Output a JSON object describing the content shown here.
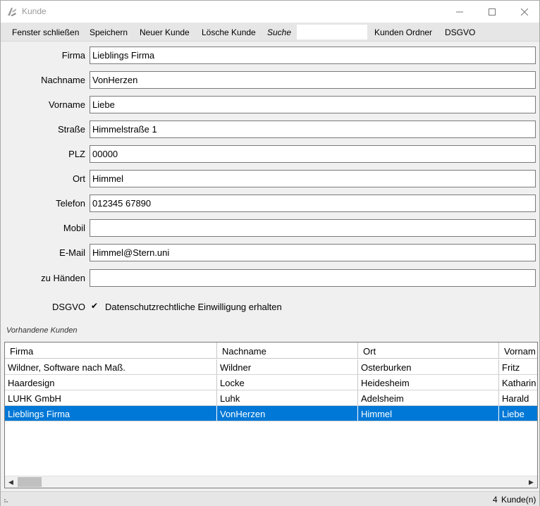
{
  "window": {
    "title": "Kunde"
  },
  "menu": {
    "close_window": "Fenster schließen",
    "save": "Speichern",
    "new_customer": "Neuer Kunde",
    "delete_customer": "Lösche Kunde",
    "search_label": "Suche",
    "search_value": "",
    "customer_folder": "Kunden Ordner",
    "dsgvo": "DSGVO"
  },
  "form": {
    "firma": {
      "label": "Firma",
      "value": "Lieblings Firma"
    },
    "nachname": {
      "label": "Nachname",
      "value": "VonHerzen"
    },
    "vorname": {
      "label": "Vorname",
      "value": "Liebe"
    },
    "strasse": {
      "label": "Straße",
      "value": "Himmelstraße 1"
    },
    "plz": {
      "label": "PLZ",
      "value": "00000"
    },
    "ort": {
      "label": "Ort",
      "value": "Himmel"
    },
    "telefon": {
      "label": "Telefon",
      "value": "012345 67890"
    },
    "mobil": {
      "label": "Mobil",
      "value": ""
    },
    "email": {
      "label": "E-Mail",
      "value": "Himmel@Stern.uni"
    },
    "zu_haenden": {
      "label": "zu Händen",
      "value": ""
    },
    "dsgvo": {
      "label": "DSGVO",
      "checkbox_text": "Datenschutzrechtliche Einwilligung erhalten",
      "checked": true,
      "check_glyph": "✔"
    }
  },
  "existing_label": "Vorhandene Kunden",
  "grid": {
    "columns": [
      "Firma",
      "Nachname",
      "Ort",
      "Vornam"
    ],
    "rows": [
      [
        "Wildner, Software nach Maß.",
        "Wildner",
        "Osterburken",
        "Fritz"
      ],
      [
        "Haardesign",
        "Locke",
        "Heidesheim",
        "Katharin"
      ],
      [
        "LUHK GmbH",
        "Luhk",
        "Adelsheim",
        "Harald"
      ],
      [
        "Lieblings Firma",
        "VonHerzen",
        "Himmel",
        "Liebe"
      ]
    ],
    "selected_row": 3
  },
  "status": {
    "count": "4",
    "unit": "Kunde(n)"
  },
  "icons": {
    "minimize": "minimize-icon",
    "maximize": "maximize-icon",
    "close": "close-icon",
    "app": "app-icon",
    "scroll_left": "arrow-left-icon",
    "scroll_right": "arrow-right-icon",
    "grip": "resize-grip-icon"
  }
}
